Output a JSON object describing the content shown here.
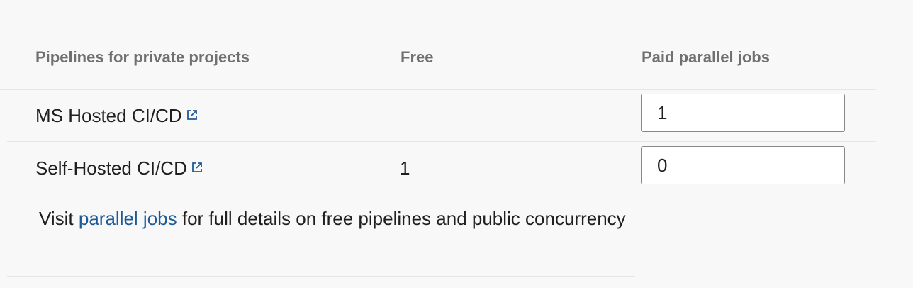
{
  "table": {
    "headers": {
      "pipelines": "Pipelines for private projects",
      "free": "Free",
      "paid": "Paid parallel jobs"
    },
    "rows": [
      {
        "name": "MS Hosted CI/CD",
        "free": "",
        "paid": "1",
        "icon": "external-link-icon"
      },
      {
        "name": "Self-Hosted CI/CD",
        "free": "1",
        "paid": "0",
        "icon": "external-link-icon"
      }
    ]
  },
  "footnote": {
    "prefix": "Visit ",
    "link": "parallel jobs",
    "suffix": " for full details on free pipelines and public concurrency"
  },
  "colors": {
    "link": "#1f5a98",
    "header_text": "#707070",
    "background": "#f8f8f8"
  }
}
